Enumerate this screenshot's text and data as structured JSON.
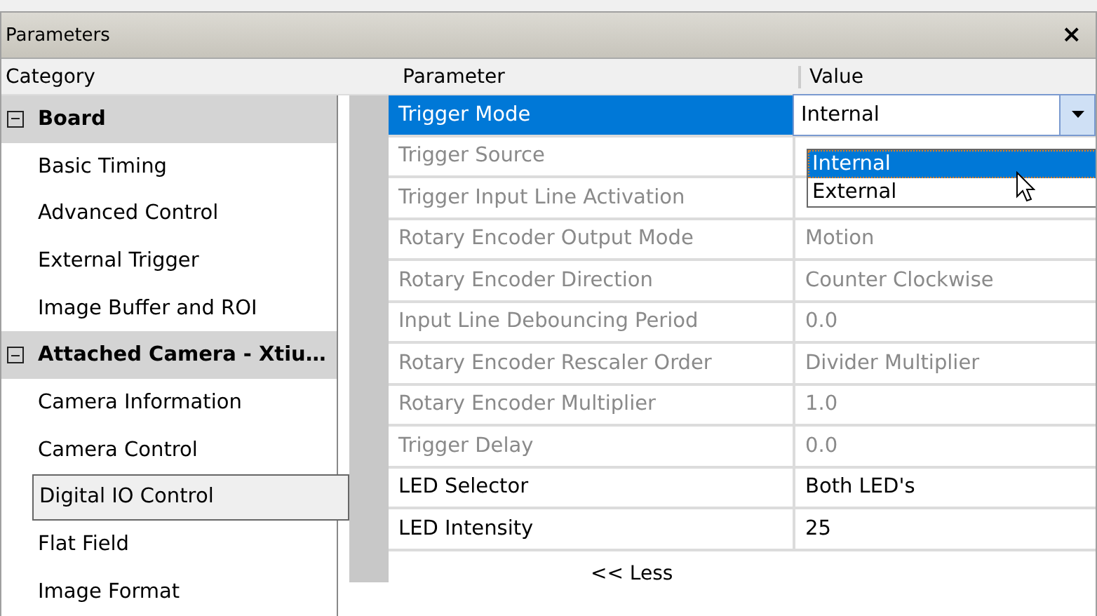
{
  "window": {
    "title": "Parameters",
    "close": "×"
  },
  "category_header": "Category",
  "categories": [
    {
      "label": "Board",
      "expanded": true,
      "children": [
        {
          "label": "Basic Timing",
          "selected": false
        },
        {
          "label": "Advanced Control",
          "selected": false
        },
        {
          "label": "External Trigger",
          "selected": false
        },
        {
          "label": "Image Buffer and ROI",
          "selected": false
        }
      ]
    },
    {
      "label": "Attached Camera - Xtiu…",
      "expanded": true,
      "children": [
        {
          "label": "Camera Information",
          "selected": false
        },
        {
          "label": "Camera Control",
          "selected": false
        },
        {
          "label": "Digital IO Control",
          "selected": true
        },
        {
          "label": "Flat Field",
          "selected": false
        },
        {
          "label": "Image Format",
          "selected": false
        }
      ]
    }
  ],
  "table": {
    "columns": [
      "Parameter",
      "Value"
    ],
    "rows": [
      {
        "parameter": "Trigger Mode",
        "value": "Internal",
        "selected": true,
        "disabled": false,
        "kind": "dropdown"
      },
      {
        "parameter": "Trigger Source",
        "selected": false,
        "disabled": true,
        "kind": "text"
      },
      {
        "parameter": "Trigger Input Line Activation",
        "selected": false,
        "disabled": true,
        "kind": "text"
      },
      {
        "parameter": "Rotary Encoder Output Mode",
        "value": "Motion",
        "selected": false,
        "disabled": true,
        "kind": "text"
      },
      {
        "parameter": "Rotary Encoder Direction",
        "value": "Counter Clockwise",
        "selected": false,
        "disabled": true,
        "kind": "text"
      },
      {
        "parameter": "Input Line Debouncing Period",
        "value": "0.0",
        "selected": false,
        "disabled": true,
        "kind": "text"
      },
      {
        "parameter": "Rotary Encoder Rescaler Order",
        "value": "Divider Multiplier",
        "selected": false,
        "disabled": true,
        "kind": "text"
      },
      {
        "parameter": "Rotary Encoder Multiplier",
        "value": "1.0",
        "selected": false,
        "disabled": true,
        "kind": "text"
      },
      {
        "parameter": "Trigger Delay",
        "value": "0.0",
        "selected": false,
        "disabled": true,
        "kind": "text"
      },
      {
        "parameter": "LED Selector",
        "value": "Both LED's",
        "selected": false,
        "disabled": false,
        "kind": "text"
      },
      {
        "parameter": "LED Intensity",
        "value": "25",
        "selected": false,
        "disabled": false,
        "kind": "text"
      }
    ]
  },
  "dropdown_options": [
    {
      "label": "Internal",
      "selected": true
    },
    {
      "label": "External",
      "selected": false
    }
  ],
  "less_button": "<< Less"
}
